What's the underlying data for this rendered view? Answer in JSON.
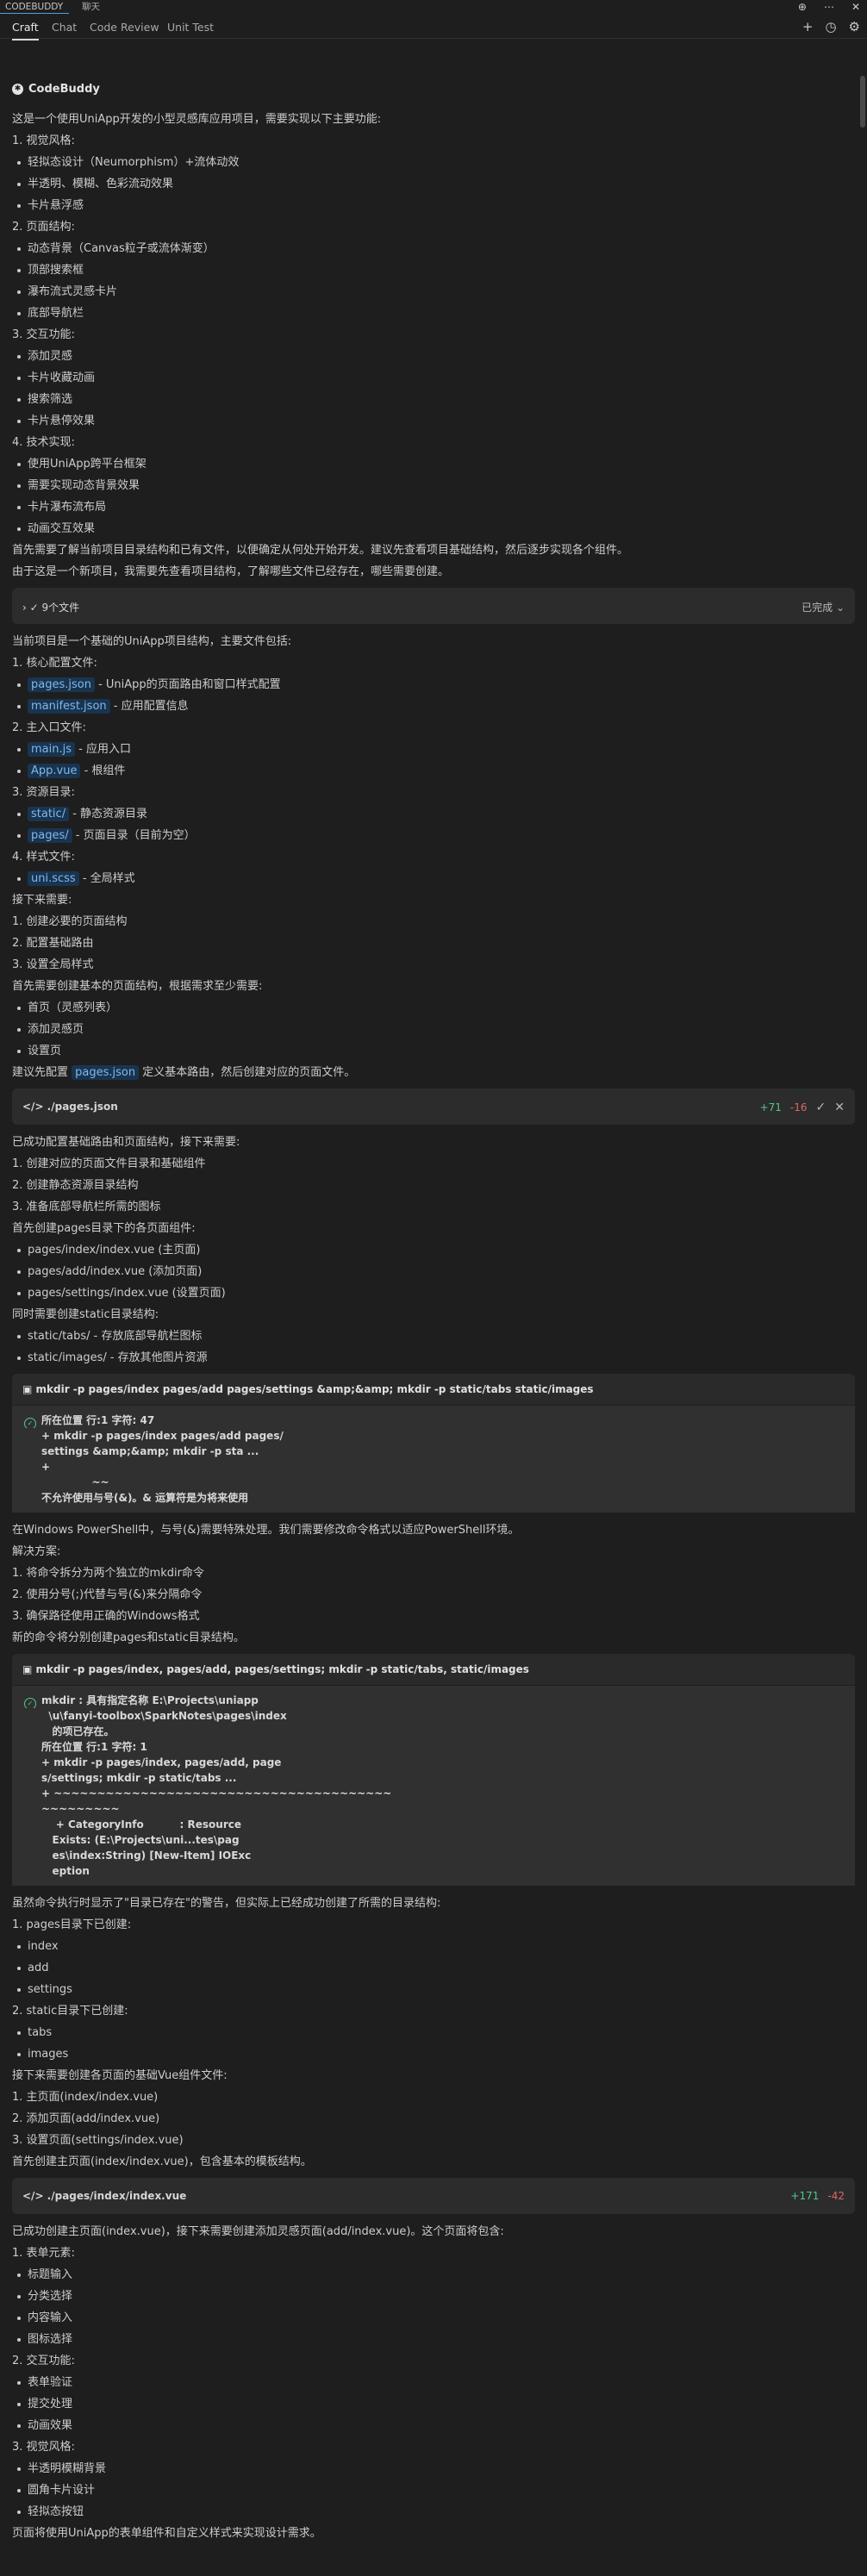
{
  "topbar": {
    "tab1": "CODEBUDDY",
    "tab2": "聊天",
    "icons": [
      "⊕",
      "⋯",
      "✕"
    ]
  },
  "tabs": [
    "Craft",
    "Chat",
    "Code Review",
    "Unit Test"
  ],
  "tab_icons": [
    "+",
    "◷",
    "⚙"
  ],
  "brand": "CodeBuddy",
  "block1": [
    {
      "t": "这是一个使用UniApp开发的小型灵感库应用项目，需要实现以下主要功能:"
    },
    {
      "t": "1. 视觉风格:"
    },
    {
      "t": "轻拟态设计（Neumorphism）+流体动效",
      "b": true
    },
    {
      "t": "半透明、模糊、色彩流动效果",
      "b": true
    },
    {
      "t": "卡片悬浮感",
      "b": true
    },
    {
      "t": "2. 页面结构:"
    },
    {
      "t": "动态背景（Canvas粒子或流体渐变）",
      "b": true
    },
    {
      "t": "顶部搜索框",
      "b": true
    },
    {
      "t": "瀑布流式灵感卡片",
      "b": true
    },
    {
      "t": "底部导航栏",
      "b": true
    },
    {
      "t": "3. 交互功能:"
    },
    {
      "t": "添加灵感",
      "b": true
    },
    {
      "t": "卡片收藏动画",
      "b": true
    },
    {
      "t": "搜索筛选",
      "b": true
    },
    {
      "t": "卡片悬停效果",
      "b": true
    },
    {
      "t": "4. 技术实现:"
    },
    {
      "t": "使用UniApp跨平台框架",
      "b": true
    },
    {
      "t": "需要实现动态背景效果",
      "b": true
    },
    {
      "t": "卡片瀑布流布局",
      "b": true
    },
    {
      "t": "动画交互效果",
      "b": true
    },
    {
      "t": "首先需要了解当前项目目录结构和已有文件，以便确定从何处开始开发。建议先查看项目基础结构，然后逐步实现各个组件。"
    },
    {
      "t": "由于这是一个新项目，我需要先查看项目结构，了解哪些文件已经存在，哪些需要创建。"
    }
  ],
  "files_bar": {
    "label": "9个文件",
    "status": "已完成"
  },
  "block2": [
    {
      "t": "当前项目是一个基础的UniApp项目结构，主要文件包括:"
    },
    {
      "t": "1. 核心配置文件:"
    },
    {
      "c": "pages.json",
      "t": " - UniApp的页面路由和窗口样式配置",
      "b": true
    },
    {
      "c": "manifest.json",
      "t": " - 应用配置信息",
      "b": true
    },
    {
      "t": "2. 主入口文件:"
    },
    {
      "c": "main.js",
      "t": " - 应用入口",
      "b": true
    },
    {
      "c": "App.vue",
      "t": " - 根组件",
      "b": true
    },
    {
      "t": "3. 资源目录:"
    },
    {
      "c": "static/",
      "t": " - 静态资源目录",
      "b": true
    },
    {
      "c": "pages/",
      "t": " - 页面目录（目前为空）",
      "b": true
    },
    {
      "t": "4. 样式文件:"
    },
    {
      "c": "uni.scss",
      "t": " - 全局样式",
      "b": true
    },
    {
      "t": "接下来需要:"
    },
    {
      "t": "1. 创建必要的页面结构"
    },
    {
      "t": "2. 配置基础路由"
    },
    {
      "t": "3. 设置全局样式"
    },
    {
      "t": "首先需要创建基本的页面结构，根据需求至少需要:"
    },
    {
      "t": "首页（灵感列表）",
      "b": true
    },
    {
      "t": "添加灵感页",
      "b": true
    },
    {
      "t": "设置页",
      "b": true
    },
    {
      "p": "建议先配置 ",
      "c": "pages.json",
      "t": " 定义基本路由，然后创建对应的页面文件。"
    }
  ],
  "file1": {
    "name": "./pages.json",
    "add": "+71",
    "del": "-16"
  },
  "block3": [
    {
      "t": "已成功配置基础路由和页面结构，接下来需要:"
    },
    {
      "t": "1. 创建对应的页面文件目录和基础组件"
    },
    {
      "t": "2. 创建静态资源目录结构"
    },
    {
      "t": "3. 准备底部导航栏所需的图标"
    },
    {
      "t": "首先创建pages目录下的各页面组件:"
    },
    {
      "t": "pages/index/index.vue (主页面)",
      "b": true
    },
    {
      "t": "pages/add/index.vue (添加页面)",
      "b": true
    },
    {
      "t": "pages/settings/index.vue (设置页面)",
      "b": true
    },
    {
      "t": "同时需要创建static目录结构:"
    },
    {
      "t": "static/tabs/ - 存放底部导航栏图标",
      "b": true
    },
    {
      "t": "static/images/ - 存放其他图片资源",
      "b": true
    }
  ],
  "term1": {
    "cmd": "mkdir -p pages/index pages/add pages/settings &amp;&amp; mkdir -p static/tabs static/images",
    "lines": [
      "所在位置 行:1 字符: 47",
      "+ mkdir -p pages/index pages/add pages/",
      "settings &amp;&amp; mkdir -p sta ...",
      "+",
      "              ~~",
      "不允许使用与号(&)。& 运算符是为将来使用"
    ]
  },
  "block4": [
    {
      "t": "在Windows PowerShell中，与号(&)需要特殊处理。我们需要修改命令格式以适应PowerShell环境。"
    },
    {
      "t": "解决方案:"
    },
    {
      "t": "1. 将命令拆分为两个独立的mkdir命令"
    },
    {
      "t": "2. 使用分号(;)代替与号(&)来分隔命令"
    },
    {
      "t": "3. 确保路径使用正确的Windows格式"
    },
    {
      "t": "新的命令将分别创建pages和static目录结构。"
    }
  ],
  "term2": {
    "cmd": "mkdir -p pages/index, pages/add, pages/settings; mkdir -p static/tabs, static/images",
    "lines": [
      "mkdir : 具有指定名称 E:\\Projects\\uniapp",
      "  \\u\\fanyi-toolbox\\SparkNotes\\pages\\index",
      "   的项已存在。",
      "所在位置 行:1 字符: 1",
      "+ mkdir -p pages/index, pages/add, page",
      "s/settings; mkdir -p static/tabs ...",
      "+ ~~~~~~~~~~~~~~~~~~~~~~~~~~~~~~~~~~~~~~~",
      "~~~~~~~~~",
      "    + CategoryInfo          : Resource  ",
      "   Exists: (E:\\Projects\\uni...tes\\pag  ",
      "   es\\index:String) [New-Item] IOExc    ",
      "   eption"
    ]
  },
  "block5": [
    {
      "t": "虽然命令执行时显示了\"目录已存在\"的警告，但实际上已经成功创建了所需的目录结构:"
    },
    {
      "t": "1. pages目录下已创建:"
    },
    {
      "t": "index",
      "b": true
    },
    {
      "t": "add",
      "b": true
    },
    {
      "t": "settings",
      "b": true
    },
    {
      "t": "2. static目录下已创建:"
    },
    {
      "t": "tabs",
      "b": true
    },
    {
      "t": "images",
      "b": true
    },
    {
      "t": "接下来需要创建各页面的基础Vue组件文件:"
    },
    {
      "t": "1. 主页面(index/index.vue)"
    },
    {
      "t": "2. 添加页面(add/index.vue)"
    },
    {
      "t": "3. 设置页面(settings/index.vue)"
    },
    {
      "t": "首先创建主页面(index/index.vue)，包含基本的模板结构。"
    }
  ],
  "file2": {
    "name": "./pages/index/index.vue",
    "add": "+171",
    "del": "-42"
  },
  "block6": [
    {
      "t": "已成功创建主页面(index.vue)，接下来需要创建添加灵感页面(add/index.vue)。这个页面将包含:"
    },
    {
      "t": "1. 表单元素:"
    },
    {
      "t": "标题输入",
      "b": true
    },
    {
      "t": "分类选择",
      "b": true
    },
    {
      "t": "内容输入",
      "b": true
    },
    {
      "t": "图标选择",
      "b": true
    },
    {
      "t": "2. 交互功能:"
    },
    {
      "t": "表单验证",
      "b": true
    },
    {
      "t": "提交处理",
      "b": true
    },
    {
      "t": "动画效果",
      "b": true
    },
    {
      "t": "3. 视觉风格:"
    },
    {
      "t": "半透明模糊背景",
      "b": true
    },
    {
      "t": "圆角卡片设计",
      "b": true
    },
    {
      "t": "轻拟态按钮",
      "b": true
    },
    {
      "t": "页面将使用UniApp的表单组件和自定义样式来实现设计需求。"
    }
  ]
}
